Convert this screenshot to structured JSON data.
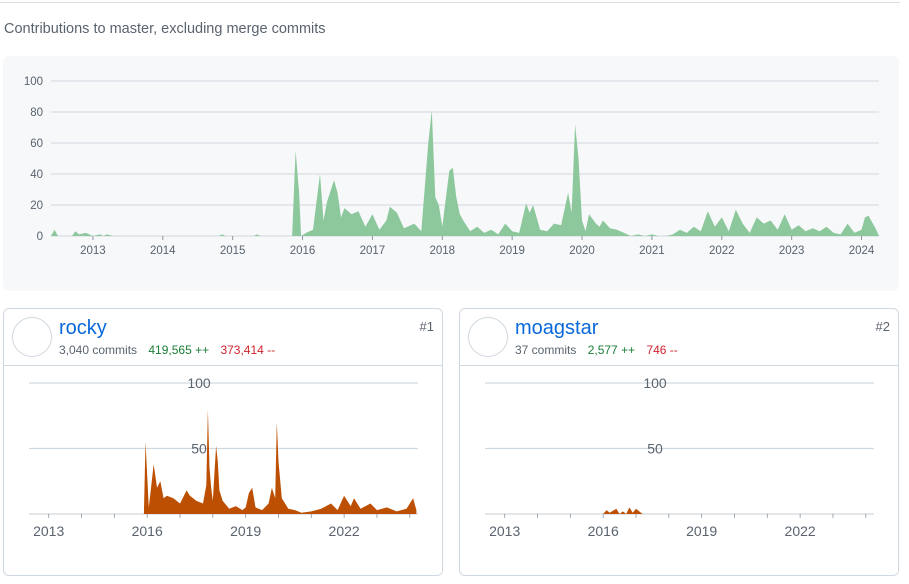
{
  "header": {
    "subtitle": "Contributions to master, excluding merge commits"
  },
  "colors": {
    "main_area": "#8cc89c",
    "user_area": "#bd4f02",
    "grid": "#d1d9e0",
    "added": "#1a7f37",
    "deleted": "#cf222e",
    "link": "#0969da"
  },
  "contributors": [
    {
      "login": "rocky",
      "commits_text": "3,040 commits",
      "additions_text": "419,565 ++",
      "deletions_text": "373,414 --",
      "rank": "#1"
    },
    {
      "login": "moagstar",
      "commits_text": "37 commits",
      "additions_text": "2,577 ++",
      "deletions_text": "746 --",
      "rank": "#2"
    }
  ],
  "chart_data": [
    {
      "type": "area",
      "title": "",
      "x_unit": "year",
      "xlim": [
        2012.4,
        2024.25
      ],
      "ylim": [
        0,
        100
      ],
      "y_ticks": [
        0,
        20,
        40,
        60,
        80,
        100
      ],
      "x_ticks": [
        "2013",
        "2014",
        "2015",
        "2016",
        "2017",
        "2018",
        "2019",
        "2020",
        "2021",
        "2022",
        "2023",
        "2024"
      ],
      "grid": true,
      "series": [
        {
          "x": [
            2012.4,
            2012.45,
            2012.5,
            2012.7,
            2012.75,
            2012.8,
            2012.9,
            2013.0,
            2013.1,
            2013.15,
            2013.2,
            2013.3,
            2014.0,
            2014.8,
            2014.85,
            2014.9,
            2015.3,
            2015.35,
            2015.4,
            2015.85,
            2015.9,
            2015.95,
            2015.98,
            2016.05,
            2016.15,
            2016.25,
            2016.3,
            2016.35,
            2016.45,
            2016.5,
            2016.55,
            2016.6,
            2016.7,
            2016.8,
            2016.9,
            2017.0,
            2017.1,
            2017.2,
            2017.25,
            2017.35,
            2017.45,
            2017.5,
            2017.6,
            2017.7,
            2017.8,
            2017.85,
            2017.9,
            2017.95,
            2018.0,
            2018.1,
            2018.15,
            2018.2,
            2018.25,
            2018.3,
            2018.4,
            2018.5,
            2018.6,
            2018.7,
            2018.8,
            2018.9,
            2019.0,
            2019.1,
            2019.2,
            2019.25,
            2019.3,
            2019.4,
            2019.5,
            2019.6,
            2019.7,
            2019.8,
            2019.85,
            2019.9,
            2019.95,
            2020.0,
            2020.05,
            2020.1,
            2020.2,
            2020.25,
            2020.3,
            2020.4,
            2020.5,
            2020.6,
            2020.7,
            2020.8,
            2020.9,
            2021.0,
            2021.1,
            2021.2,
            2021.3,
            2021.4,
            2021.5,
            2021.6,
            2021.7,
            2021.8,
            2021.9,
            2022.0,
            2022.1,
            2022.2,
            2022.3,
            2022.4,
            2022.5,
            2022.6,
            2022.7,
            2022.8,
            2022.9,
            2023.0,
            2023.1,
            2023.2,
            2023.3,
            2023.4,
            2023.5,
            2023.6,
            2023.7,
            2023.8,
            2023.9,
            2024.0,
            2024.05,
            2024.1,
            2024.2,
            2024.25
          ],
          "y": [
            0,
            4,
            0,
            0,
            3,
            1,
            2,
            0,
            1,
            0,
            1,
            0,
            0,
            0,
            1,
            0,
            0,
            1,
            0,
            0,
            55,
            28,
            0,
            2,
            4,
            40,
            10,
            22,
            36,
            28,
            12,
            18,
            14,
            16,
            6,
            14,
            4,
            10,
            19,
            15,
            5,
            6,
            8,
            3,
            60,
            81,
            25,
            20,
            6,
            42,
            44,
            25,
            14,
            10,
            3,
            6,
            2,
            4,
            1,
            8,
            3,
            2,
            21,
            15,
            20,
            4,
            3,
            8,
            7,
            28,
            15,
            72,
            50,
            10,
            3,
            14,
            8,
            6,
            10,
            5,
            4,
            2,
            0,
            1,
            0,
            1,
            0,
            0,
            1,
            4,
            2,
            6,
            3,
            16,
            6,
            12,
            3,
            17,
            8,
            2,
            12,
            8,
            10,
            4,
            14,
            4,
            7,
            3,
            5,
            3,
            6,
            2,
            1,
            8,
            2,
            4,
            12,
            13,
            5,
            0
          ]
        }
      ]
    },
    {
      "type": "area",
      "series": [
        {
          "name": "rocky"
        }
      ],
      "ylim": [
        0,
        100
      ],
      "y_ticks": [
        50,
        100
      ],
      "x_ticks": [
        "2013",
        "2016",
        "2019",
        "2022"
      ],
      "grid": true,
      "x": [
        2012.4,
        2015.9,
        2015.95,
        2016.05,
        2016.2,
        2016.3,
        2016.4,
        2016.5,
        2016.6,
        2016.8,
        2017.0,
        2017.2,
        2017.3,
        2017.5,
        2017.7,
        2017.8,
        2017.85,
        2017.9,
        2017.95,
        2018.0,
        2018.1,
        2018.15,
        2018.2,
        2018.3,
        2018.5,
        2018.7,
        2018.9,
        2019.0,
        2019.1,
        2019.2,
        2019.3,
        2019.5,
        2019.7,
        2019.8,
        2019.9,
        2019.95,
        2020.0,
        2020.1,
        2020.2,
        2020.3,
        2020.5,
        2020.7,
        2021.0,
        2021.3,
        2021.6,
        2021.8,
        2022.0,
        2022.2,
        2022.3,
        2022.5,
        2022.8,
        2023.0,
        2023.3,
        2023.6,
        2023.9,
        2024.1,
        2024.2
      ],
      "y": [
        0,
        0,
        55,
        5,
        38,
        20,
        25,
        12,
        14,
        12,
        8,
        18,
        14,
        10,
        8,
        22,
        80,
        35,
        20,
        10,
        52,
        40,
        18,
        10,
        4,
        6,
        3,
        5,
        16,
        20,
        5,
        3,
        8,
        20,
        12,
        70,
        40,
        12,
        8,
        4,
        3,
        1,
        2,
        4,
        8,
        3,
        14,
        6,
        12,
        4,
        8,
        3,
        5,
        2,
        4,
        12,
        3
      ]
    },
    {
      "type": "area",
      "series": [
        {
          "name": "moagstar"
        }
      ],
      "ylim": [
        0,
        100
      ],
      "y_ticks": [
        50,
        100
      ],
      "x_ticks": [
        "2013",
        "2016",
        "2019",
        "2022"
      ],
      "grid": true,
      "x": [
        2012.4,
        2015.8,
        2016.0,
        2016.1,
        2016.2,
        2016.4,
        2016.5,
        2016.6,
        2016.7,
        2016.8,
        2016.9,
        2017.0,
        2017.2,
        2024.2
      ],
      "y": [
        0,
        0,
        0,
        3,
        1,
        4,
        0,
        2,
        0,
        5,
        1,
        4,
        0,
        0
      ]
    }
  ]
}
